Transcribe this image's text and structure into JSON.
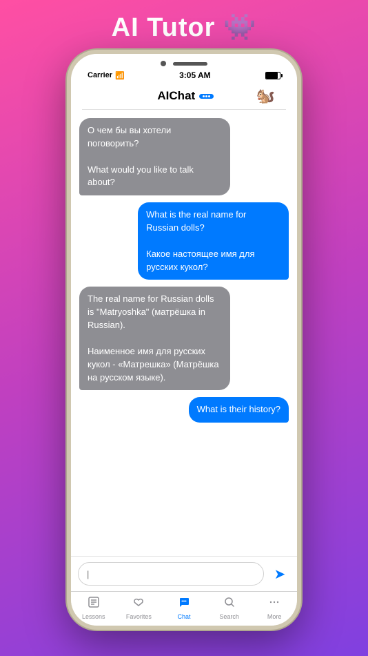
{
  "app": {
    "title": "AI Tutor 👾"
  },
  "status_bar": {
    "carrier": "Carrier",
    "wifi": "📶",
    "time": "3:05 AM"
  },
  "nav": {
    "title": "AIChat",
    "chipmunk_emoji": "🐿️"
  },
  "messages": [
    {
      "id": 1,
      "side": "left",
      "text": "О чем бы вы хотели поговорить?\n\nWhat would you like to talk about?"
    },
    {
      "id": 2,
      "side": "right",
      "text": "What is the real name for Russian dolls?\n\nКакое настоящее имя для русских кукол?"
    },
    {
      "id": 3,
      "side": "left",
      "text": "The real name for Russian dolls is \"Matryoshka\" (матрёшка in Russian).\n\nНаименное имя для русских кукол - «Матрешка» (Матрёшка на русском языке)."
    },
    {
      "id": 4,
      "side": "right",
      "text": "What is their history?"
    }
  ],
  "input": {
    "placeholder": "|",
    "value": ""
  },
  "tabs": [
    {
      "id": "lessons",
      "label": "Lessons",
      "icon": "📋",
      "active": false
    },
    {
      "id": "favorites",
      "label": "Favorites",
      "icon": "♡",
      "active": false
    },
    {
      "id": "chat",
      "label": "Chat",
      "icon": "💬",
      "active": true
    },
    {
      "id": "search",
      "label": "Search",
      "icon": "🔍",
      "active": false
    },
    {
      "id": "more",
      "label": "More",
      "icon": "•••",
      "active": false
    }
  ]
}
